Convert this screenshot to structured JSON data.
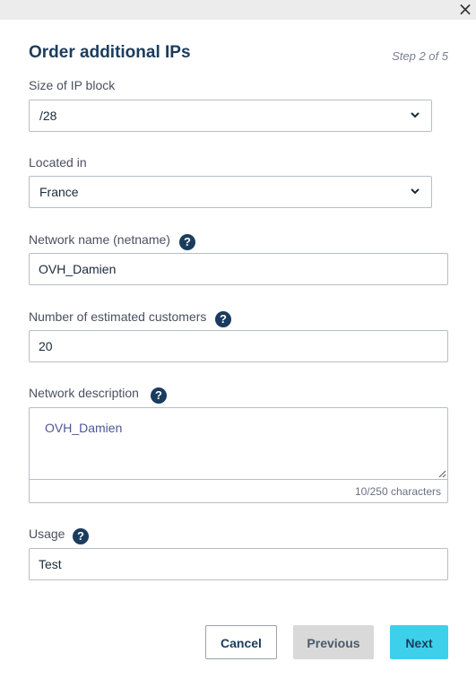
{
  "dialog": {
    "title": "Order additional IPs",
    "step": "Step 2 of 5",
    "close_symbol": "×"
  },
  "fields": {
    "ip_block": {
      "label": "Size of IP block",
      "value": "/28",
      "icon": "chevron-down-icon"
    },
    "location": {
      "label": "Located in",
      "value": "France",
      "icon": "chevron-down-icon"
    },
    "netname": {
      "label": "Network name (netname)",
      "value": "OVH_Damien",
      "help": "?"
    },
    "customers": {
      "label": "Number of estimated customers",
      "value": "20",
      "help": "?"
    },
    "description": {
      "label": "Network description",
      "value": "OVH_Damien",
      "char_count": "10/250 characters",
      "help": "?"
    },
    "usage": {
      "label": "Usage",
      "value": "Test",
      "help": "?"
    }
  },
  "buttons": {
    "cancel": "Cancel",
    "previous": "Previous",
    "next": "Next"
  },
  "colors": {
    "title": "#1a3c5e",
    "primary_button": "#3ed0ea",
    "disabled_button": "#d9d9d9",
    "help_icon": "#1a3c5e",
    "border": "#b8bdc6"
  }
}
